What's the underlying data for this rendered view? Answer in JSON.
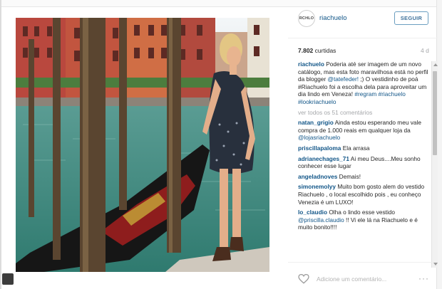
{
  "post": {
    "image_alt": "Woman in a dotted dress standing by gondolas on a Venice canal",
    "watermark": "RCHLO"
  },
  "header": {
    "avatar_text": "RCHLO",
    "username": "riachuelo",
    "follow_label": "SEGUIR"
  },
  "stats": {
    "likes_count": "7.802",
    "likes_label": "curtidas",
    "time_ago": "4 d"
  },
  "caption": {
    "user": "riachuelo",
    "text_1": "Poderia até ser imagem de um novo catálogo, mas esta foto maravilhosa está no perfil da blogger ",
    "mention": "@tatefeder!",
    "text_2": " ;) O vestidinho de poá #Riachuelo foi a escolha dela para aproveitar um dia lindo em Veneza! ",
    "hashtags": "#regram #riachuelo #lookriachuelo"
  },
  "view_all_comments": "ver todos os 51 comentários",
  "comments": [
    {
      "user": "natan_grigio",
      "text": " Ainda estou esperando meu vale compra de 1.000 reais em qualquer loja da ",
      "link": "@lojasriachuelo",
      "tail": ""
    },
    {
      "user": "priscillapaloma",
      "text": " Ela arrasa",
      "link": "",
      "tail": ""
    },
    {
      "user": "adrianechages_71",
      "text": " Ai meu Deus....Meu sonho conhecer esse lugar",
      "link": "",
      "tail": ""
    },
    {
      "user": "angeladnoves",
      "text": " Demais!",
      "link": "",
      "tail": ""
    },
    {
      "user": "simonemolyy",
      "text": " Muito bom gosto alem do vestido Riachuelo , o local escolhido pois , eu conheço Venezia é um LUXO!",
      "link": "",
      "tail": ""
    },
    {
      "user": "lo_claudio",
      "text": " Olha o lindo esse vestido ",
      "link": "@priscilla.claudio",
      "tail": " !! Vi ele lá na Riachuelo e é muito bonito!!!!"
    }
  ],
  "footer": {
    "comment_placeholder": "Adicione um comentário...",
    "more_label": "···"
  }
}
